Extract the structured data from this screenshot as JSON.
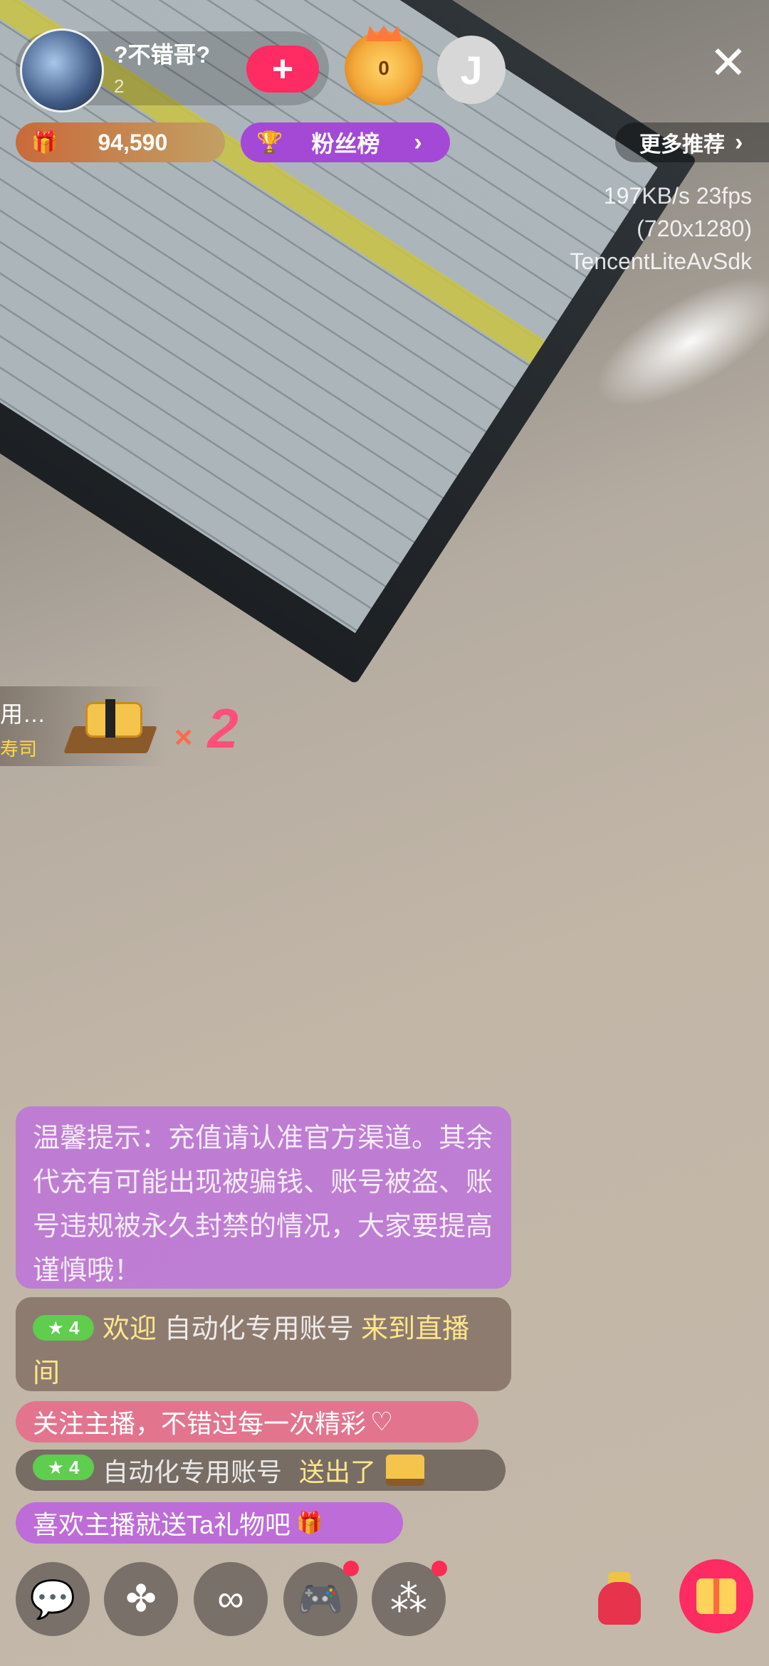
{
  "header": {
    "host_name": "?不错哥?",
    "host_sub": "2",
    "follow_icon": "+",
    "medal_value": "0",
    "grey_icon": "J",
    "close_icon": "✕"
  },
  "stats_bar": {
    "gift_icon": "🎁",
    "coins": "94,590",
    "trophy_icon": "🏆",
    "fans_label": "粉丝榜",
    "fans_chevron": "›",
    "more_label": "更多推荐",
    "more_chevron": "›"
  },
  "stream_stats": {
    "line1": "197KB/s 23fps",
    "line2": "(720x1280)",
    "line3": "TencentLiteAvSdk"
  },
  "gift_combo": {
    "sender_trunc": "用…",
    "gift_name_trunc": "寿司",
    "multiplier_sign": "×",
    "count": "2"
  },
  "chat": {
    "notice": "温馨提示：充值请认准官方渠道。其余代充有可能出现被骗钱、账号被盗、账号违规被永久封禁的情况，大家要提高谨慎哦！",
    "welcome_level": "4",
    "welcome_prefix": "欢迎",
    "welcome_user": "自动化专用账号",
    "welcome_suffix": "来到直播间",
    "follow_tip": "关注主播，不错过每一次精彩",
    "follow_tip_icon": "♡",
    "gift_level": "4",
    "gift_user": "自动化专用账号",
    "gift_action": "送出了",
    "like_tip": "喜欢主播就送Ta礼物吧",
    "like_tip_icon": "🎁"
  },
  "toolbar": {
    "comment_icon": "💬",
    "games_icon": "✤",
    "link_icon": "∞",
    "gamepad_icon": "🎮",
    "more_icon": "⁂"
  },
  "colors": {
    "accent_pink": "#ff2b63",
    "fans_purple": "#a349d6",
    "level_green": "#5fcd4e",
    "highlight_yellow": "#ffe68a"
  }
}
